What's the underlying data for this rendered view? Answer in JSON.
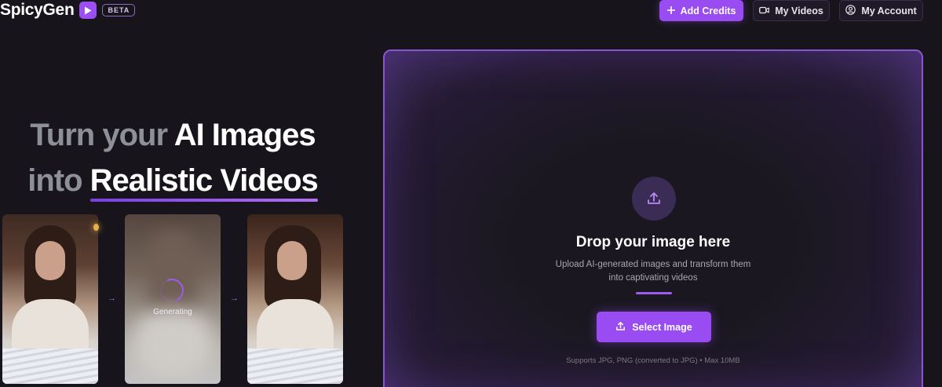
{
  "header": {
    "brand_name": "SpicyGen",
    "beta_label": "BETA",
    "add_credits_label": "Add Credits",
    "my_videos_label": "My Videos",
    "my_account_label": "My Account"
  },
  "hero": {
    "line1_dim": "Turn your",
    "line1_bright": "AI Images",
    "line2_dim": "into",
    "line2_accent": "Realistic Videos"
  },
  "preview": {
    "generating_label": "Generating",
    "arrow_glyph": "→"
  },
  "dropzone": {
    "title": "Drop your image here",
    "subtitle_line1": "Upload AI-generated images and transform them",
    "subtitle_line2": "into captivating videos",
    "button_label": "Select Image",
    "supports_text": "Supports JPG, PNG (converted to JPG) • Max 10MB"
  },
  "colors": {
    "accent": "#9a4cf3",
    "background": "#17151b",
    "muted_text": "#8d8f99"
  },
  "icons": {
    "brand": "play-icon",
    "credits": "plus-icon",
    "videos": "video-camera-icon",
    "account": "user-circle-icon",
    "upload": "upload-icon"
  }
}
